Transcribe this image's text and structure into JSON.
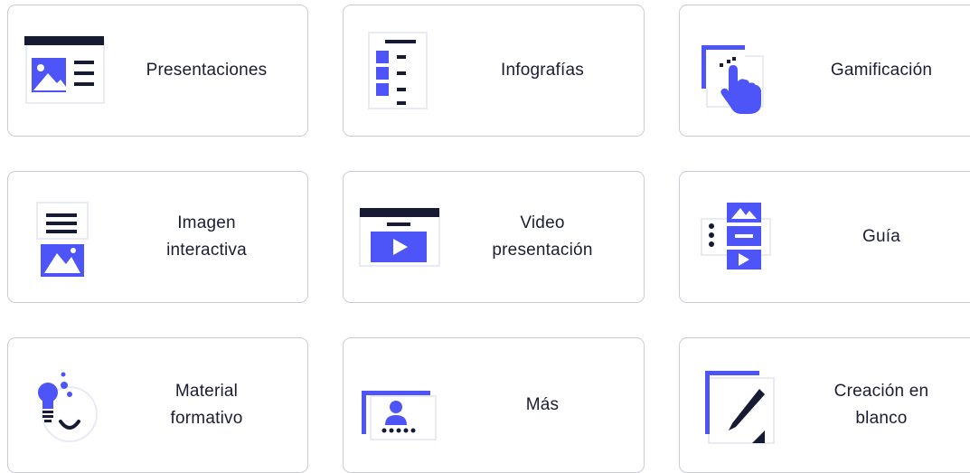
{
  "accent_color": "#4e55f8",
  "dark_color": "#161a33",
  "templates": [
    {
      "label": "Presentaciones",
      "icon": "presentation-icon"
    },
    {
      "label": "Infografías",
      "icon": "infographic-icon"
    },
    {
      "label": "Gamificación",
      "icon": "gamification-icon"
    },
    {
      "label": "Imagen\ninteractiva",
      "icon": "interactive-image-icon"
    },
    {
      "label": "Video\npresentación",
      "icon": "video-presentation-icon"
    },
    {
      "label": "Guía",
      "icon": "guide-icon"
    },
    {
      "label": "Material\nformativo",
      "icon": "training-material-icon"
    },
    {
      "label": "Más",
      "icon": "more-icon"
    },
    {
      "label": "Creación en\nblanco",
      "icon": "blank-creation-icon"
    }
  ]
}
